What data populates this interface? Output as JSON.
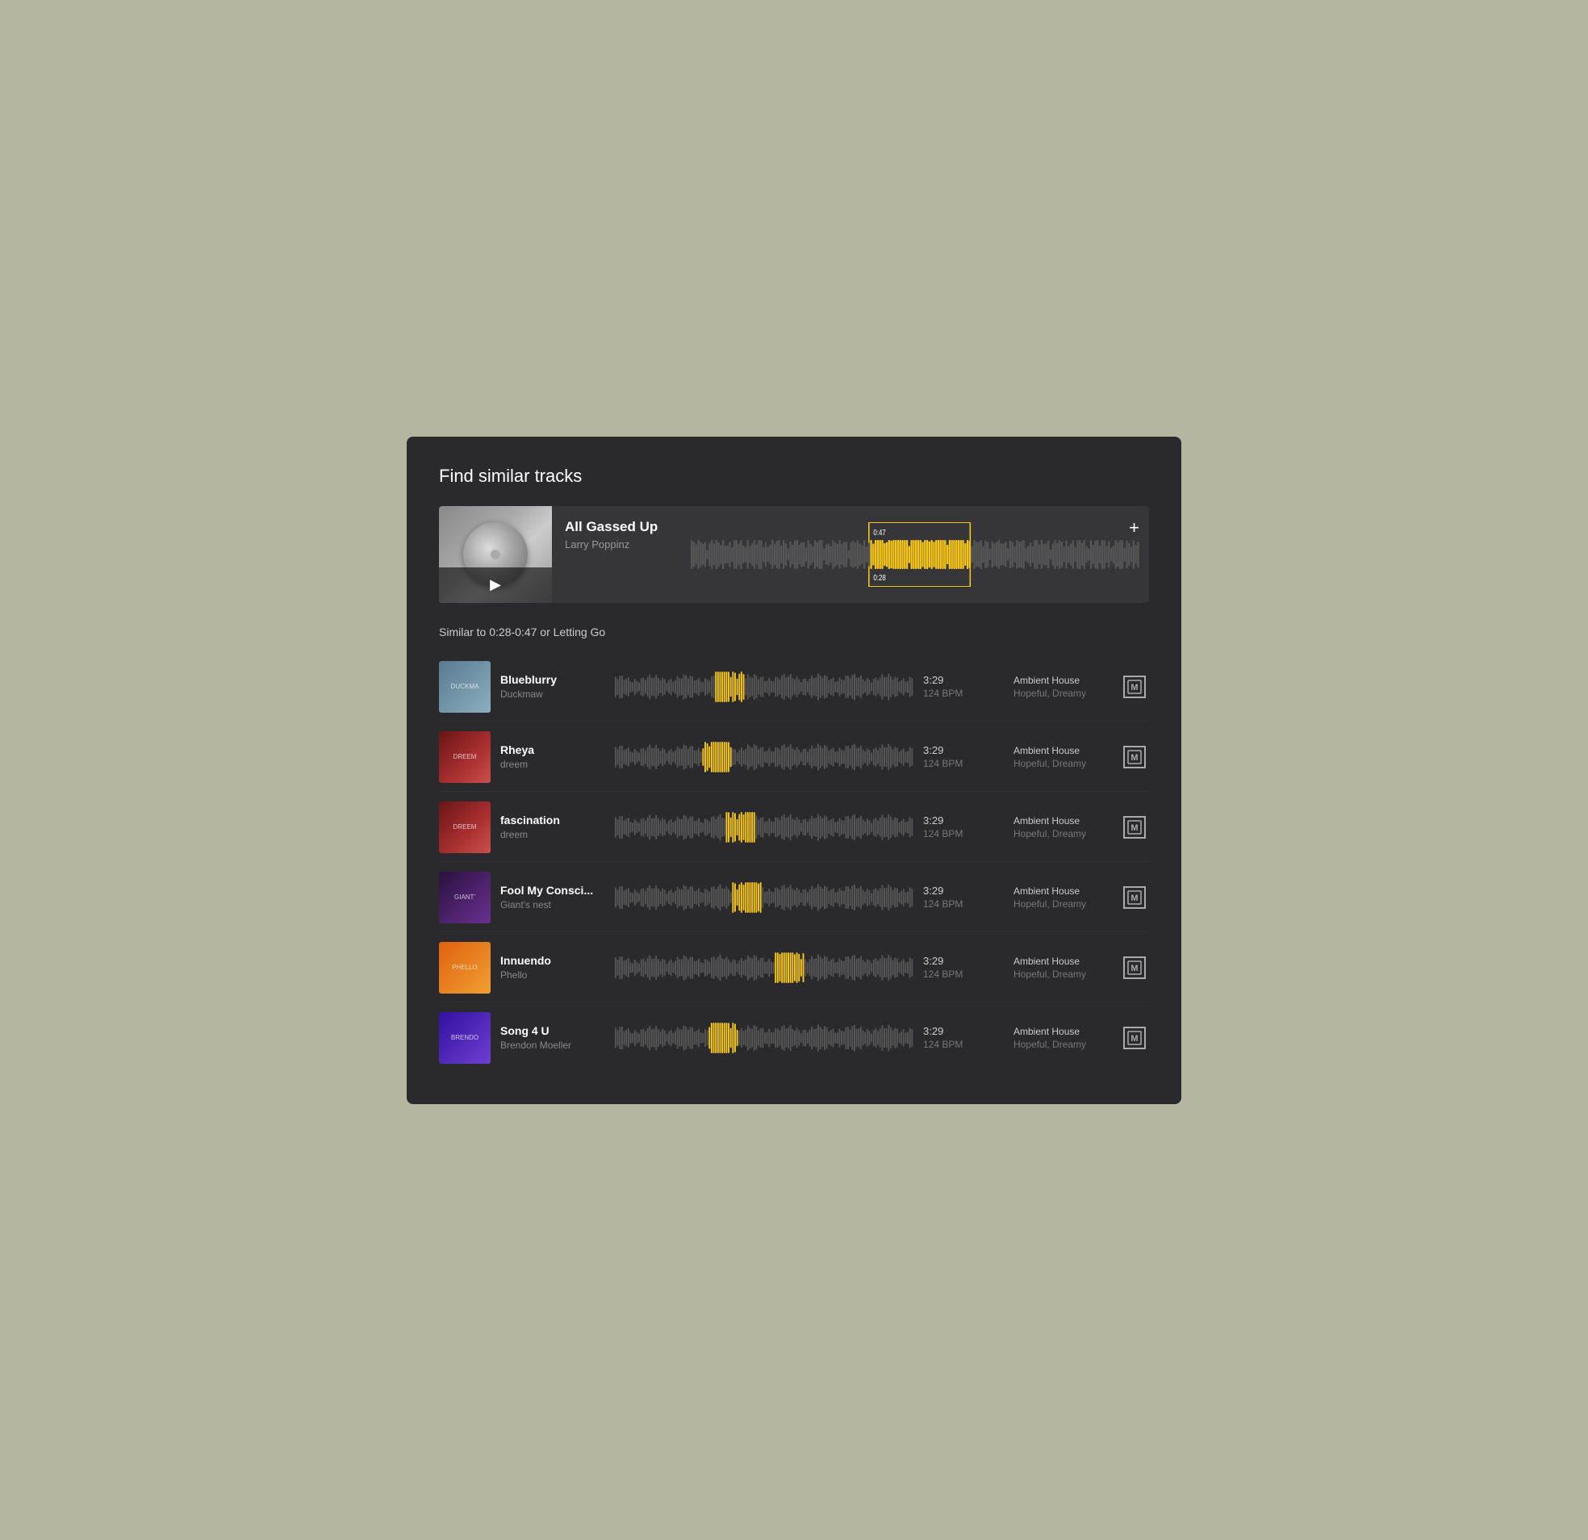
{
  "page": {
    "title": "Find similar tracks"
  },
  "source_track": {
    "title": "All Gassed Up",
    "artist": "Larry Poppinz",
    "range_start": "0:28",
    "range_end": "0:47",
    "play_label": "▶"
  },
  "similar_header": "Similar to 0:28-0:47 or Letting Go",
  "add_button": "+",
  "tracks": [
    {
      "name": "Blueblurry",
      "artist": "Duckmaw",
      "duration": "3:29",
      "bpm": "124 BPM",
      "genre": "Ambient House",
      "mood": "Hopeful, Dreamy",
      "thumb_color": "#7a8fa0",
      "highlight_position": 0.38
    },
    {
      "name": "Rheya",
      "artist": "dreem",
      "duration": "3:29",
      "bpm": "124 BPM",
      "genre": "Ambient House",
      "mood": "Hopeful, Dreamy",
      "thumb_color": "#8B2020",
      "highlight_position": 0.34
    },
    {
      "name": "fascination",
      "artist": "dreem",
      "duration": "3:29",
      "bpm": "124 BPM",
      "genre": "Ambient House",
      "mood": "Hopeful, Dreamy",
      "thumb_color": "#8B2020",
      "highlight_position": 0.42
    },
    {
      "name": "Fool My Consci...",
      "artist": "Giant's nest",
      "duration": "3:29",
      "bpm": "124 BPM",
      "genre": "Ambient House",
      "mood": "Hopeful, Dreamy",
      "thumb_color": "#4a2060",
      "highlight_position": 0.44
    },
    {
      "name": "Innuendo",
      "artist": "Phello",
      "duration": "3:29",
      "bpm": "124 BPM",
      "genre": "Ambient House",
      "mood": "Hopeful, Dreamy",
      "thumb_color": "#d08040",
      "highlight_position": 0.58
    },
    {
      "name": "Song 4 U",
      "artist": "Brendon Moeller",
      "duration": "3:29",
      "bpm": "124 BPM",
      "genre": "Ambient House",
      "mood": "Hopeful, Dreamy",
      "thumb_color": "#5030a0",
      "highlight_position": 0.36
    }
  ],
  "action_icon_label": "[M]",
  "colors": {
    "accent": "#f5c518",
    "waveform_base": "#555",
    "waveform_highlight": "#f5c518",
    "background": "#2a2a2e"
  }
}
